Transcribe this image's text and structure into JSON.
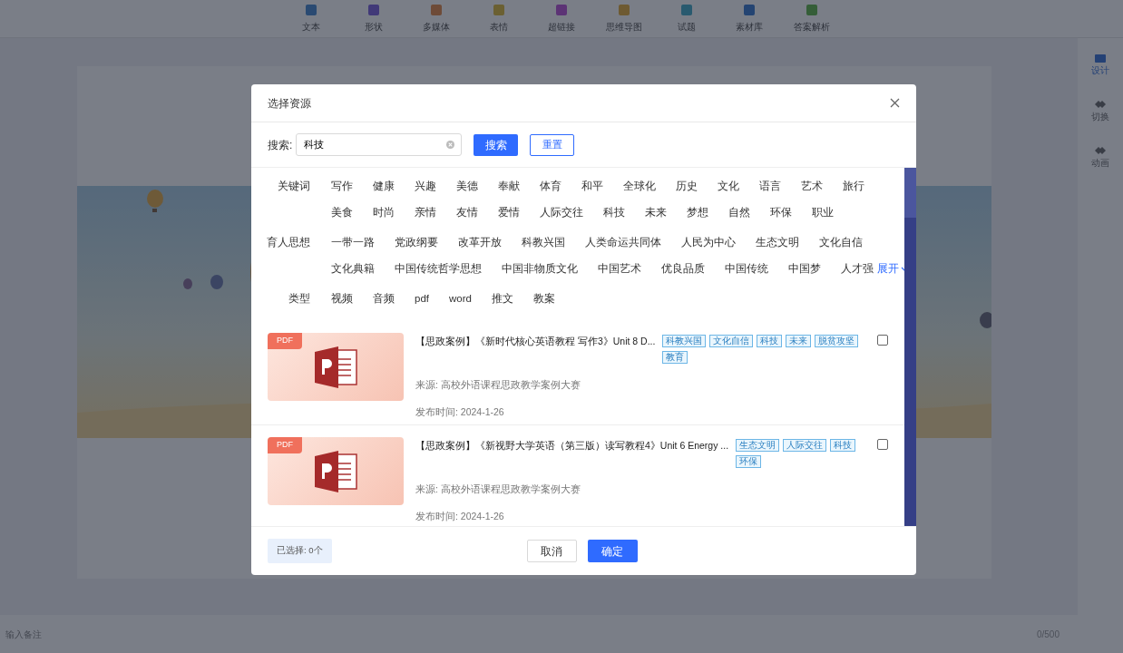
{
  "toolbar": [
    {
      "label": "文本"
    },
    {
      "label": "形状"
    },
    {
      "label": "多媒体"
    },
    {
      "label": "表情"
    },
    {
      "label": "超链接"
    },
    {
      "label": "思维导图"
    },
    {
      "label": "试题"
    },
    {
      "label": "素材库"
    },
    {
      "label": "答案解析"
    }
  ],
  "side_panel": [
    {
      "label": "设计",
      "selected": true
    },
    {
      "label": "切换",
      "selected": false
    },
    {
      "label": "动画",
      "selected": false
    }
  ],
  "notes": {
    "placeholder": "输入备注",
    "counter": "0/500"
  },
  "dialog": {
    "title": "选择资源",
    "search": {
      "label": "搜索:",
      "value": "科技"
    },
    "search_button": "搜索",
    "reset_button": "重置",
    "filters": [
      {
        "label": "关键词",
        "lines": [
          {
            "tags": [
              "写作",
              "健康",
              "兴趣",
              "美德",
              "奉献",
              "体育",
              "和平",
              "全球化",
              "历史",
              "文化",
              "语言",
              "艺术",
              "旅行"
            ]
          },
          {
            "tags": [
              "美食",
              "时尚",
              "亲情",
              "友情",
              "爱情",
              "人际交往",
              "科技",
              "未来",
              "梦想",
              "自然",
              "环保",
              "职业"
            ]
          }
        ]
      },
      {
        "label": "育人思想",
        "lines": [
          {
            "tags": [
              "一带一路",
              "党政纲要",
              "改革开放",
              "科教兴国",
              "人类命运共同体",
              "人民为中心",
              "生态文明",
              "文化自信"
            ]
          },
          {
            "tags": [
              "文化典籍",
              "中国传统哲学思想",
              "中国非物质文化",
              "中国艺术",
              "优良品质",
              "中国传统",
              "中国梦",
              "人才强"
            ]
          }
        ],
        "expand": "展开"
      },
      {
        "label": "类型",
        "lines": [
          {
            "tags": [
              "视频",
              "音频",
              "pdf",
              "word",
              "推文",
              "教案"
            ]
          }
        ]
      }
    ],
    "resources": [
      {
        "badge": "PDF",
        "title": "【思政案例】《新时代核心英语教程 写作3》Unit 8 D...",
        "tags": [
          "科教兴国",
          "文化自信",
          "科技",
          "未来",
          "脱贫攻坚",
          "教育"
        ],
        "source": "来源: 高校外语课程思政教学案例大赛",
        "date": "发布时间: 2024-1-26",
        "checked": false
      },
      {
        "badge": "PDF",
        "title": "【思政案例】《新视野大学英语（第三版）读写教程4》Unit 6 Energy ...",
        "tags": [
          "生态文明",
          "人际交往",
          "科技",
          "环保"
        ],
        "source": "来源: 高校外语课程思政教学案例大赛",
        "date": "发布时间: 2024-1-26",
        "checked": false
      }
    ],
    "selected_count": "已选择: 0个",
    "cancel": "取消",
    "confirm": "确定"
  }
}
